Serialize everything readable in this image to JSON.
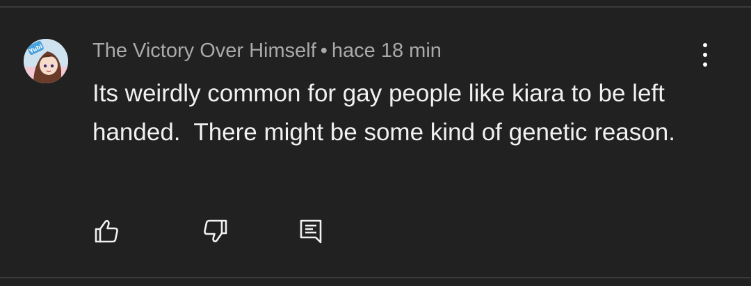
{
  "comment": {
    "author": "The Victory Over Himself",
    "separator": "•",
    "time": "hace 18 min",
    "text": "Its weirdly common for gay people like kiara to be left handed.  There might be some kind of genetic reason.",
    "avatar_badge": "Yubi"
  },
  "actions": {
    "like_icon": "thumbs-up-icon",
    "dislike_icon": "thumbs-down-icon",
    "reply_icon": "reply-comment-icon",
    "more_icon": "more-vertical-icon"
  },
  "colors": {
    "background": "#212121",
    "divider": "#3a3a3a",
    "meta_text": "#aaaaaa",
    "body_text": "#f1f1f1"
  }
}
